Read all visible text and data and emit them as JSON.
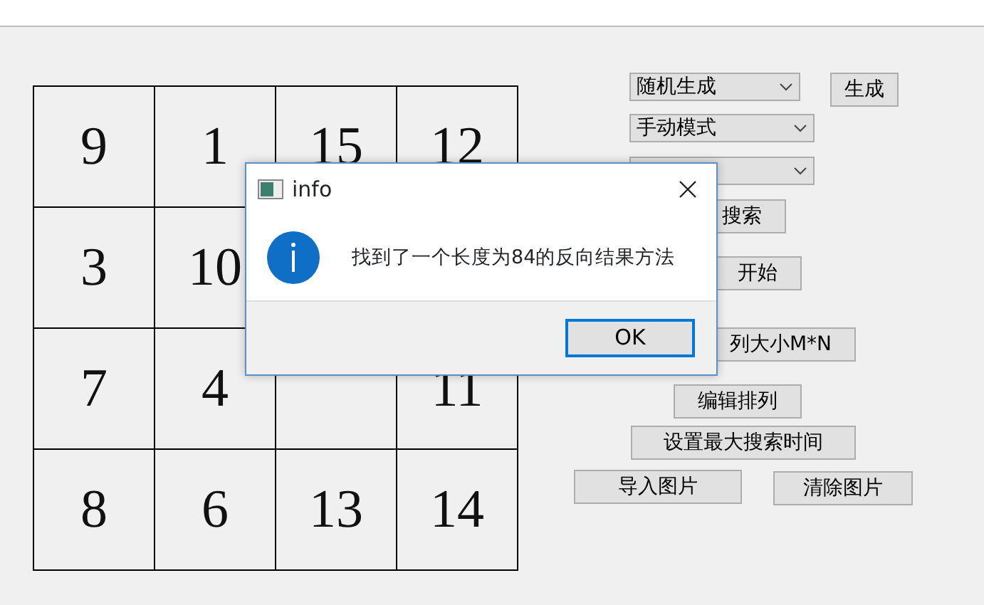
{
  "board": {
    "rows": [
      [
        "9",
        "1",
        "15",
        "12"
      ],
      [
        "3",
        "10",
        null,
        null
      ],
      [
        "7",
        "4",
        "",
        "11"
      ],
      [
        "8",
        "6",
        "13",
        "14"
      ]
    ]
  },
  "controls": [
    {
      "kind": "combo",
      "value": "随机生成"
    },
    {
      "kind": "button",
      "label": "生成"
    },
    {
      "kind": "combo",
      "value": "手动模式"
    },
    {
      "kind": "combo"
    },
    {
      "kind": "button",
      "label": "搜索"
    },
    {
      "kind": "button",
      "label": "开始"
    },
    {
      "kind": "button",
      "label": "列大小M*N"
    },
    {
      "kind": "button",
      "label": "编辑排列"
    },
    {
      "kind": "button",
      "label": "设置最大搜索时间"
    },
    {
      "kind": "button",
      "label": "导入图片"
    },
    {
      "kind": "button",
      "label": "清除图片"
    }
  ],
  "dialog": {
    "title": "info",
    "message": "找到了一个长度为84的反向结果方法",
    "buttons": [
      {
        "label": "OK",
        "focused": true
      }
    ]
  }
}
